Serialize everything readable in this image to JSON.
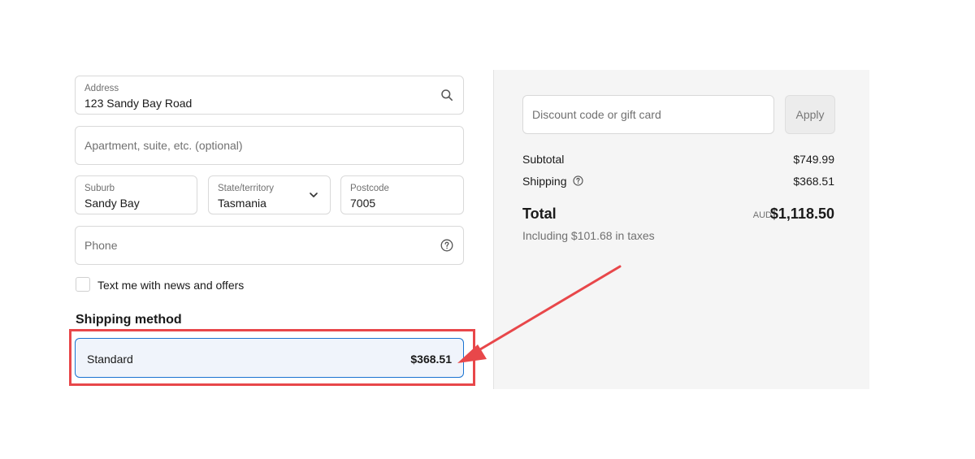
{
  "form": {
    "address": {
      "label": "Address",
      "value": "123 Sandy Bay Road"
    },
    "apartment": {
      "placeholder": "Apartment, suite, etc. (optional)"
    },
    "suburb": {
      "label": "Suburb",
      "value": "Sandy Bay"
    },
    "state": {
      "label": "State/territory",
      "value": "Tasmania"
    },
    "postcode": {
      "label": "Postcode",
      "value": "7005"
    },
    "phone": {
      "placeholder": "Phone"
    },
    "sms_optin_label": "Text me with news and offers"
  },
  "shipping": {
    "heading": "Shipping method",
    "option": {
      "name": "Standard",
      "price": "$368.51"
    }
  },
  "summary": {
    "discount_placeholder": "Discount code or gift card",
    "apply_label": "Apply",
    "subtotal_label": "Subtotal",
    "subtotal_value": "$749.99",
    "shipping_label": "Shipping",
    "shipping_value": "$368.51",
    "total_label": "Total",
    "currency": "AUD",
    "total_value": "$1,118.50",
    "taxes_note": "Including $101.68 in taxes"
  },
  "icons": {
    "address": "search-icon",
    "state": "chevron-down-icon",
    "phone": "help-circle-icon",
    "shipping_info": "help-circle-icon"
  },
  "colors": {
    "selected_border": "#1a73d1",
    "highlight": "#e8474a",
    "panel_bg": "#f5f5f5"
  }
}
